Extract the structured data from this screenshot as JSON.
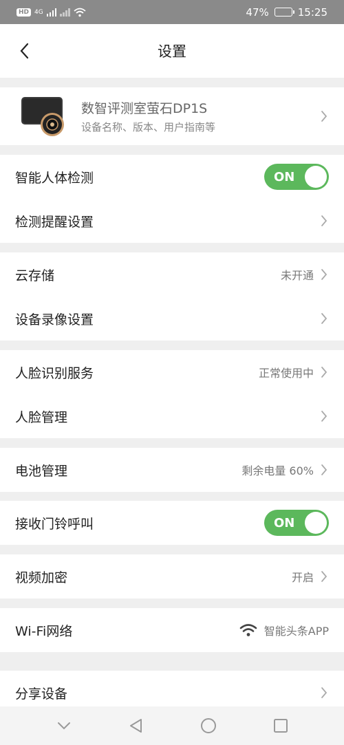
{
  "status_bar": {
    "hd": "HD",
    "network": "4G",
    "battery_text": "47%",
    "battery_level": 0.47,
    "time": "15:25"
  },
  "header": {
    "title": "设置"
  },
  "device": {
    "name": "数智评测室萤石DP1S",
    "subtitle": "设备名称、版本、用户指南等"
  },
  "settings": {
    "human_detection": {
      "label": "智能人体检测",
      "toggle": "ON"
    },
    "detection_alert": {
      "label": "检测提醒设置"
    },
    "cloud_storage": {
      "label": "云存储",
      "value": "未开通"
    },
    "recording": {
      "label": "设备录像设置"
    },
    "face_service": {
      "label": "人脸识别服务",
      "value": "正常使用中"
    },
    "face_manage": {
      "label": "人脸管理"
    },
    "battery": {
      "label": "电池管理",
      "value": "剩余电量 60%"
    },
    "doorbell": {
      "label": "接收门铃呼叫",
      "toggle": "ON"
    },
    "video_encrypt": {
      "label": "视频加密",
      "value": "开启"
    },
    "wifi": {
      "label": "Wi-Fi网络",
      "value": "智能头条APP"
    },
    "share": {
      "label": "分享设备"
    }
  },
  "colors": {
    "toggle_on": "#5cb85c",
    "status_bar": "#8a8a8a"
  }
}
